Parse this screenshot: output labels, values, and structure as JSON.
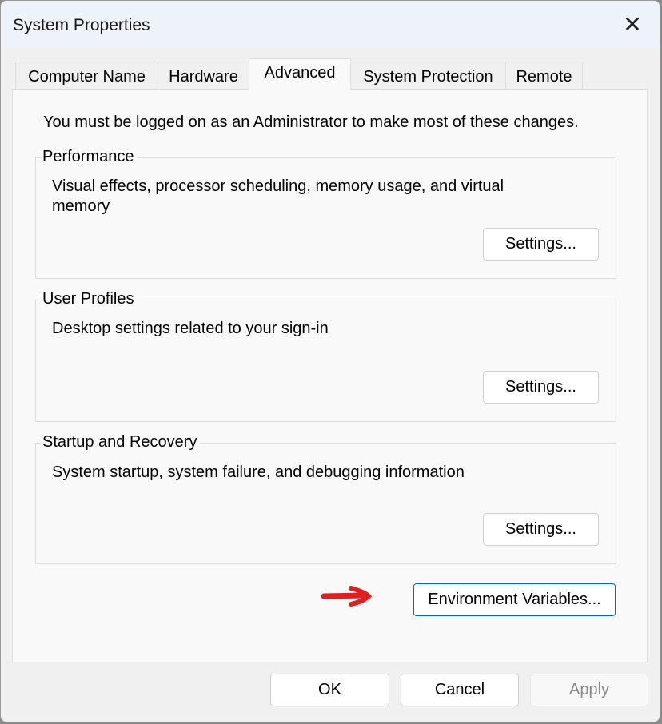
{
  "window": {
    "title": "System Properties",
    "close_icon": "close-icon"
  },
  "tabs": [
    {
      "label": "Computer Name",
      "selected": false
    },
    {
      "label": "Hardware",
      "selected": false
    },
    {
      "label": "Advanced",
      "selected": true
    },
    {
      "label": "System Protection",
      "selected": false
    },
    {
      "label": "Remote",
      "selected": false
    }
  ],
  "advanced": {
    "admin_note": "You must be logged on as an Administrator to make most of these changes.",
    "groups": [
      {
        "label": "Performance",
        "description": "Visual effects, processor scheduling, memory usage, and virtual memory",
        "button": "Settings..."
      },
      {
        "label": "User Profiles",
        "description": "Desktop settings related to your sign-in",
        "button": "Settings..."
      },
      {
        "label": "Startup and Recovery",
        "description": "System startup, system failure, and debugging information",
        "button": "Settings..."
      }
    ],
    "env_button": "Environment Variables...",
    "annotation_color": "#e02020"
  },
  "footer": {
    "ok": "OK",
    "cancel": "Cancel",
    "apply": "Apply"
  }
}
